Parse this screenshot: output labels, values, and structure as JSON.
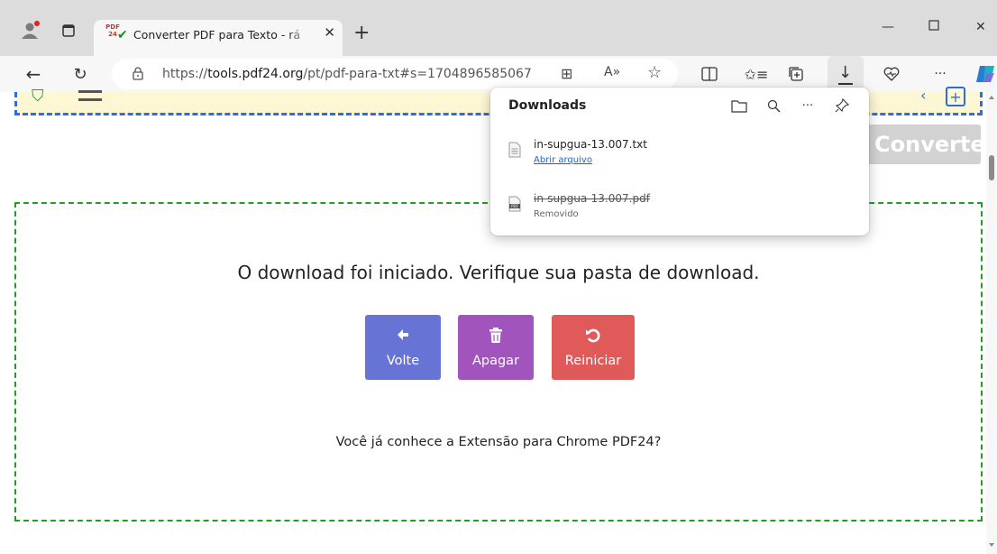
{
  "browser": {
    "tab_title": "Converter PDF para Texto - rá",
    "favicon_text": "PDF 24",
    "url_prefix": "https://",
    "url_domain": "tools.pdf24.org",
    "url_path": "/pt/pdf-para-txt#s=1704896585067"
  },
  "downloads": {
    "header": "Downloads",
    "items": [
      {
        "filename": "in-supgua-13.007.txt",
        "status": "Abrir arquivo",
        "file_type": "txt"
      },
      {
        "filename": "in-supgua-13.007.pdf",
        "status": "Removido",
        "file_type": "pdf"
      }
    ]
  },
  "page": {
    "convert_button": "Converter",
    "message": "O download foi iniciado. Verifique sua pasta de download.",
    "actions": [
      {
        "label": "Volte",
        "icon": "arrow-left-icon",
        "color": "#6873d6"
      },
      {
        "label": "Apagar",
        "icon": "trash-icon",
        "color": "#a254bd"
      },
      {
        "label": "Reiniciar",
        "icon": "restart-icon",
        "color": "#e05a5a"
      }
    ],
    "extension_text": "Você já conhece a Extensão para Chrome PDF24?"
  },
  "colors": {
    "link": "#1d63c8",
    "result_border": "#20a020",
    "toolbar_border": "#2f6ed8"
  }
}
